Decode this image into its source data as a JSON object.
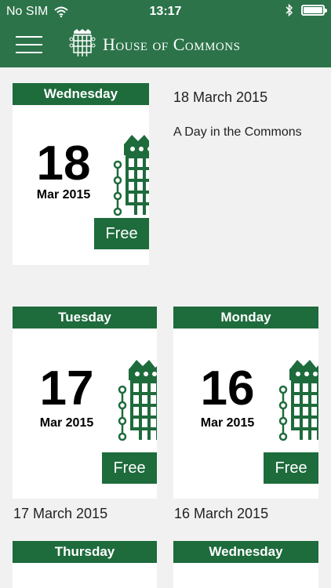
{
  "status": {
    "carrier": "No SIM",
    "time": "13:17"
  },
  "header": {
    "title": "House of Commons"
  },
  "featured": {
    "day": "Wednesday",
    "date_num": "18",
    "month_year": "Mar 2015",
    "price": "Free",
    "date_label": "18 March 2015",
    "subtitle": "A Day in the Commons"
  },
  "cards": [
    {
      "day": "Tuesday",
      "date_num": "17",
      "month_year": "Mar 2015",
      "price": "Free",
      "date_label": "17 March 2015"
    },
    {
      "day": "Monday",
      "date_num": "16",
      "month_year": "Mar 2015",
      "price": "Free",
      "date_label": "16 March 2015"
    },
    {
      "day": "Thursday"
    },
    {
      "day": "Wednesday"
    }
  ],
  "colors": {
    "brand_green": "#2c7349",
    "banner_green": "#1e6b3c"
  }
}
